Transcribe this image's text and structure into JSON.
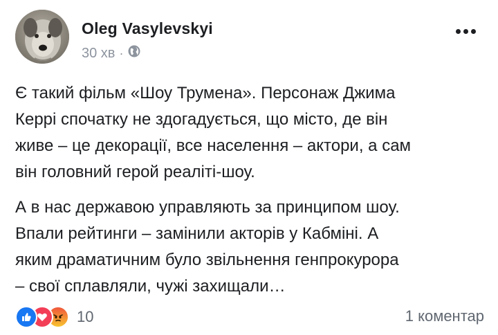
{
  "post": {
    "author": "Oleg Vasylevskyi",
    "timestamp": "30 хв",
    "separator": "·",
    "privacy_icon": "globe-icon",
    "paragraphs": [
      "Є такий фільм «Шоу Трумена». Персонаж Джима\nКеррі спочатку не здогадується, що місто, де він\nживе – це декорації, все населення – актори, а сам\nвін головний герой реаліті-шоу.",
      "А в нас державою управляють за принципом шоу.\nВпали рейтинги – замінили акторів у Кабміні. А\nяким драматичним було звільнення генпрокурора\n– свої сплавляли, чужі захищали…"
    ],
    "reactions": {
      "icons": [
        "like-icon",
        "love-icon",
        "angry-icon"
      ],
      "count": "10"
    },
    "comments_label": "1 коментар"
  },
  "colors": {
    "like": "#1877f2",
    "love": "#f33e58",
    "angry": "#f0563b",
    "secondary_text": "#8d949e"
  }
}
